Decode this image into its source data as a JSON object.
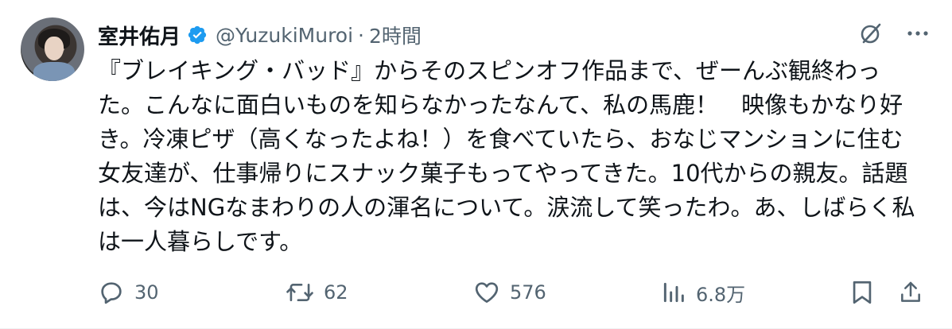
{
  "tweet": {
    "author": {
      "display_name": "室井佑月",
      "handle": "@YuzukiMuroi",
      "verified_icon": "verified-badge-icon"
    },
    "separator": "·",
    "time": "2時間",
    "body": "『ブレイキング・バッド』からそのスピンオフ作品まで、ぜーんぶ観終わった。こんなに面白いものを知らなかったなんて、私の馬鹿！　映像もかなり好き。冷凍ピザ（高くなったよね！）を食べていたら、おなじマンションに住む女友達が、仕事帰りにスナック菓子もってやってきた。10代からの親友。話題は、今はNGなまわりの人の渾名について。涙流して笑ったわ。あ、しばらく私は一人暮らしです。",
    "top_actions": [
      "grok-icon",
      "more-icon"
    ],
    "actions": {
      "reply_count": "30",
      "retweet_count": "62",
      "like_count": "576",
      "views_count": "6.8万"
    },
    "colors": {
      "text_primary": "#0f1419",
      "text_secondary": "#536471",
      "verified": "#1d9bf0"
    }
  }
}
